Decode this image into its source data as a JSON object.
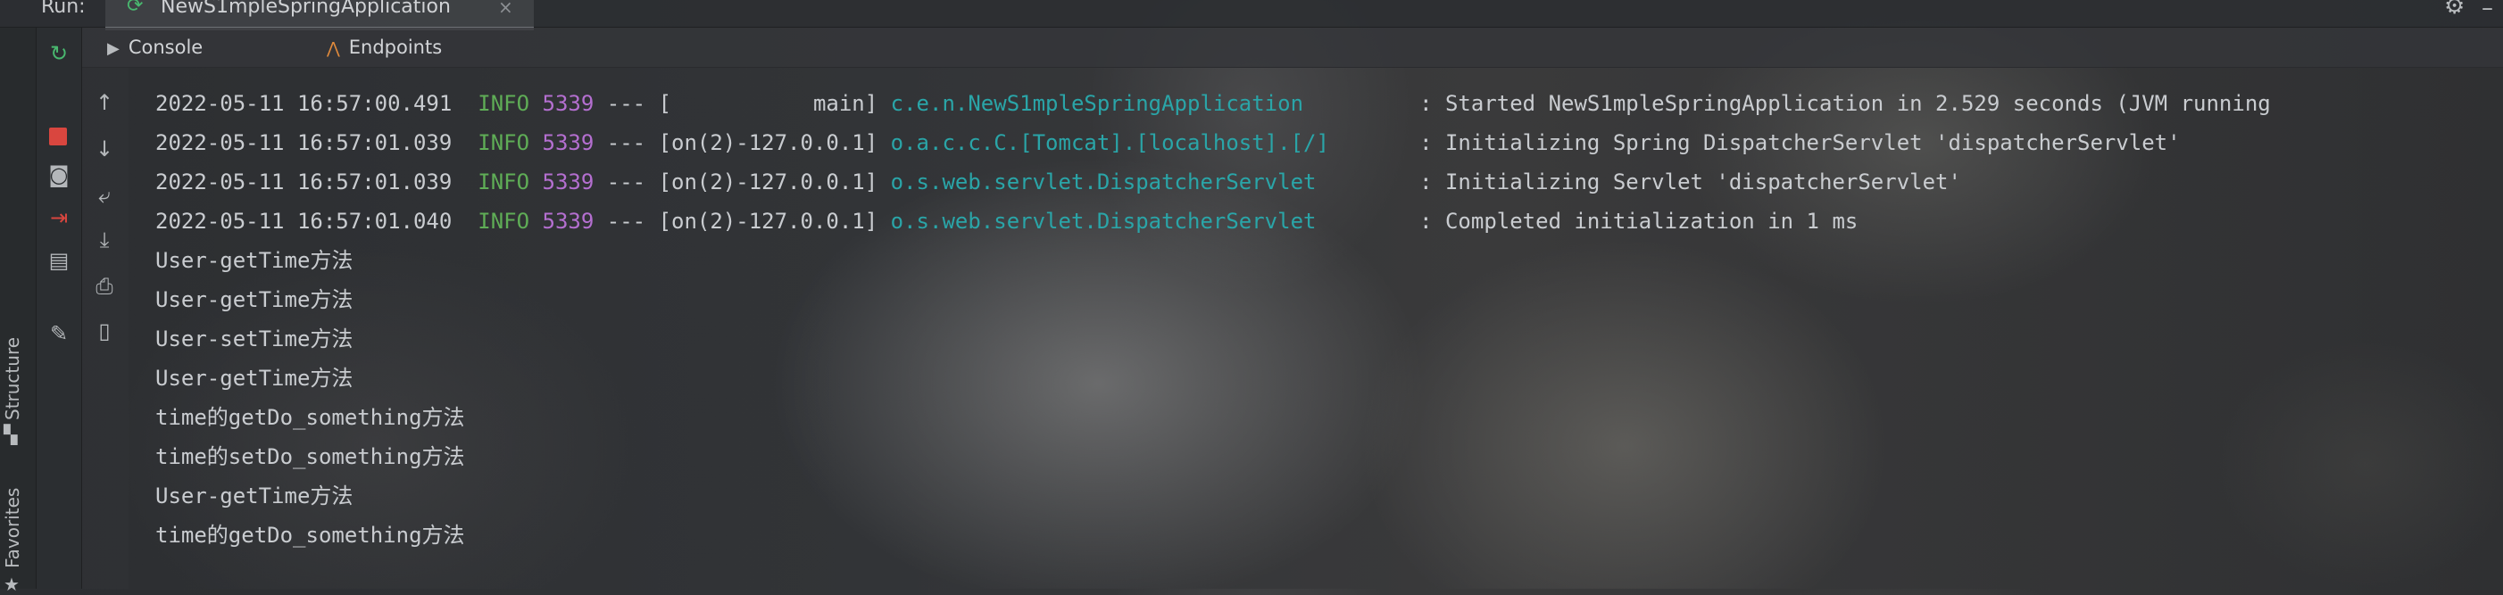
{
  "run_bar": {
    "label": "Run:",
    "tab_title": "NewS1mpleSpringApplication",
    "close_glyph": "×",
    "settings_icon": "gear-icon",
    "hide_icon": "minus-icon"
  },
  "left_strip": {
    "structure_label": "Structure",
    "favorites_label": "Favorites"
  },
  "tool_buttons": [
    {
      "name": "rerun-icon",
      "glyph": "↻"
    },
    {
      "name": "stop-icon",
      "glyph": ""
    },
    {
      "name": "camera-icon",
      "glyph": "📷"
    },
    {
      "name": "exit-icon",
      "glyph": "⇥"
    },
    {
      "name": "layout-icon",
      "glyph": "▤"
    },
    {
      "name": "pin-icon",
      "glyph": "📌"
    }
  ],
  "console_tools": [
    {
      "name": "up-arrow-icon",
      "glyph": "↑"
    },
    {
      "name": "down-arrow-icon",
      "glyph": "↓"
    },
    {
      "name": "soft-wrap-icon",
      "glyph": "⤶"
    },
    {
      "name": "scroll-to-end-icon",
      "glyph": "⤓"
    },
    {
      "name": "print-icon",
      "glyph": "⎙"
    },
    {
      "name": "trash-icon",
      "glyph": "🗑"
    }
  ],
  "tabs": [
    {
      "label": "Console",
      "icon": "console-icon"
    },
    {
      "label": "Endpoints",
      "icon": "endpoints-icon"
    }
  ],
  "log_lines": [
    {
      "ts": "2022-05-11 16:57:00.491",
      "level": "INFO",
      "pid": "5339",
      "sep": "---",
      "thread": "[           main]",
      "logger": "c.e.n.NewS1mpleSpringApplication        ",
      "message": ": Started NewS1mpleSpringApplication in 2.529 seconds (JVM running"
    },
    {
      "ts": "2022-05-11 16:57:01.039",
      "level": "INFO",
      "pid": "5339",
      "sep": "---",
      "thread": "[on(2)-127.0.0.1]",
      "logger": "o.a.c.c.C.[Tomcat].[localhost].[/]      ",
      "message": ": Initializing Spring DispatcherServlet 'dispatcherServlet'"
    },
    {
      "ts": "2022-05-11 16:57:01.039",
      "level": "INFO",
      "pid": "5339",
      "sep": "---",
      "thread": "[on(2)-127.0.0.1]",
      "logger": "o.s.web.servlet.DispatcherServlet       ",
      "message": ": Initializing Servlet 'dispatcherServlet'"
    },
    {
      "ts": "2022-05-11 16:57:01.040",
      "level": "INFO",
      "pid": "5339",
      "sep": "---",
      "thread": "[on(2)-127.0.0.1]",
      "logger": "o.s.web.servlet.DispatcherServlet       ",
      "message": ": Completed initialization in 1 ms"
    }
  ],
  "output_lines": [
    "User-getTime方法",
    "User-getTime方法",
    "User-setTime方法",
    "User-getTime方法",
    "time的getDo_something方法",
    "time的setDo_something方法",
    "User-getTime方法",
    "time的getDo_something方法"
  ],
  "colors": {
    "level_info": "#5fad56",
    "pid": "#b46fd0",
    "logger": "#2aa5a8",
    "stop": "#d9463f",
    "rerun": "#49b86f"
  }
}
